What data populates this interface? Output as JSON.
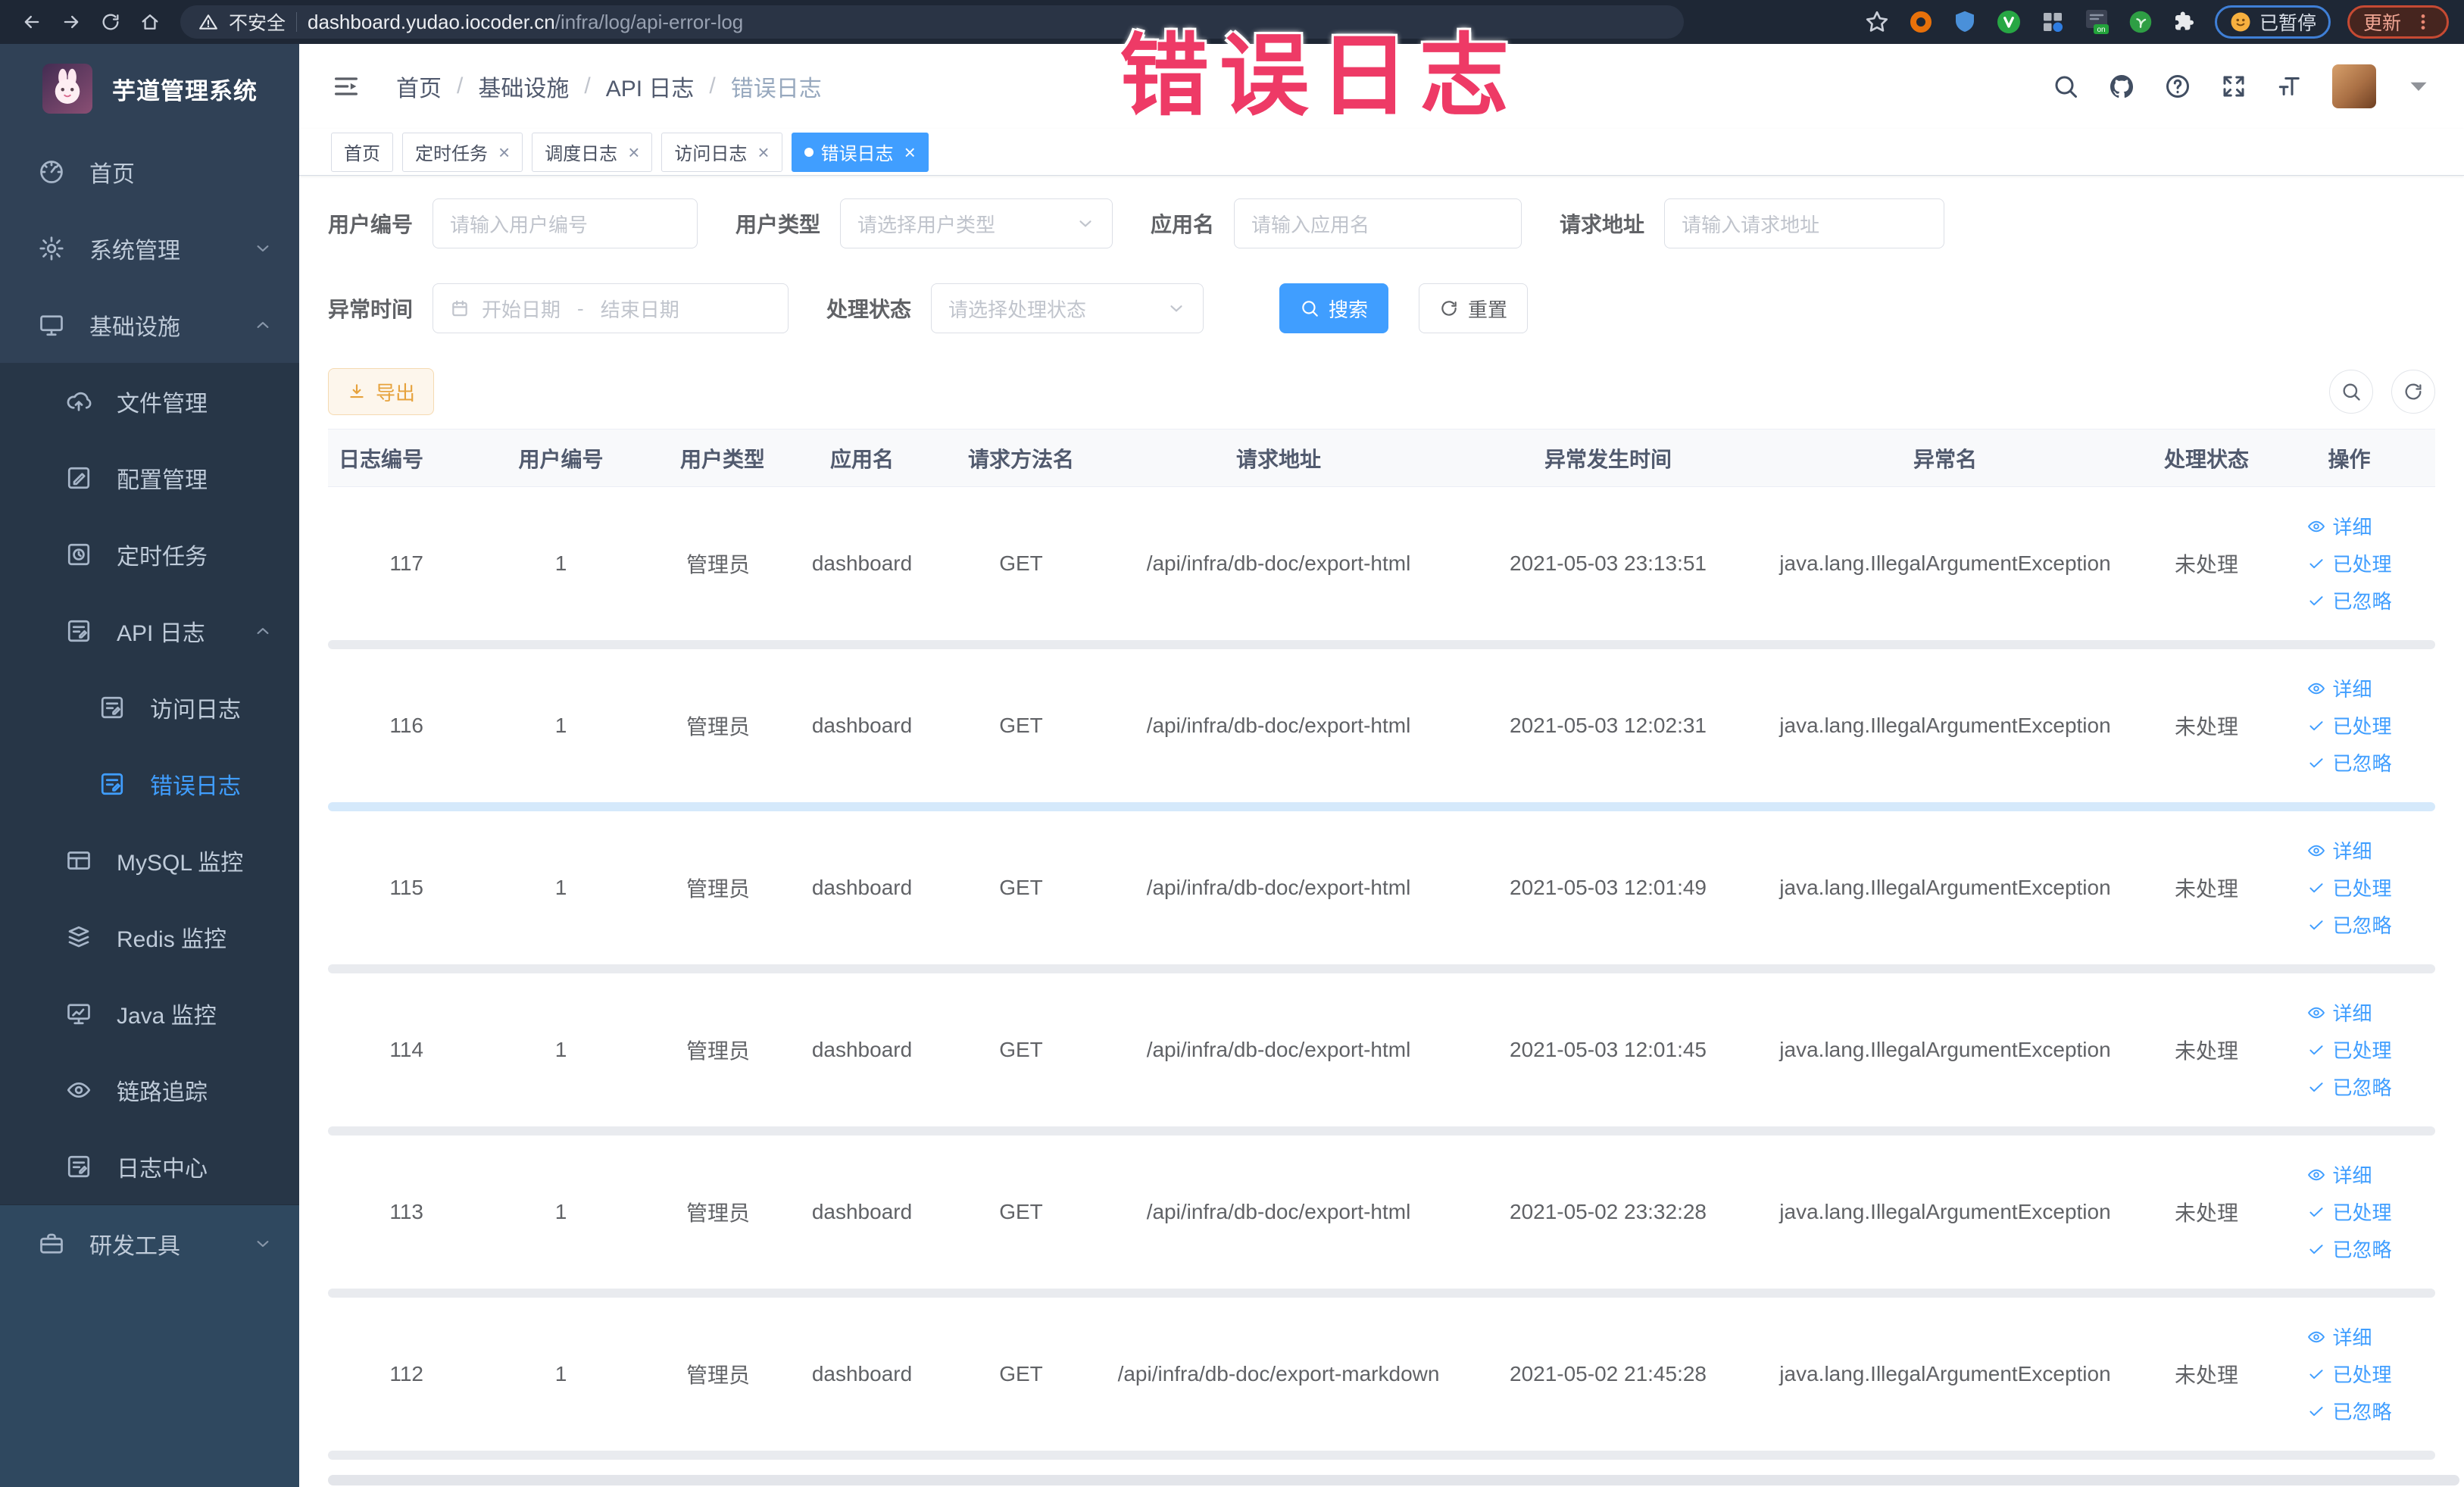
{
  "browser": {
    "security_label": "不安全",
    "url_host": "dashboard.yudao.iocoder.cn",
    "url_path": "/infra/log/api-error-log",
    "ext_on_badge": "on",
    "paused_badge": "已暂停",
    "update_label": "更新"
  },
  "watermark": "错误日志",
  "sidebar": {
    "title": "芋道管理系统",
    "items": [
      {
        "key": "home",
        "label": "首页",
        "icon": "dashboard-icon",
        "level": 1
      },
      {
        "key": "system",
        "label": "系统管理",
        "icon": "gear-icon",
        "level": 1,
        "chevron": "down"
      },
      {
        "key": "infra",
        "label": "基础设施",
        "icon": "monitor-icon",
        "level": 1,
        "chevron": "up"
      },
      {
        "key": "file",
        "label": "文件管理",
        "icon": "cloud-upload-icon",
        "level": 2,
        "dark": true
      },
      {
        "key": "config",
        "label": "配置管理",
        "icon": "edit-icon",
        "level": 2,
        "dark": true
      },
      {
        "key": "job",
        "label": "定时任务",
        "icon": "clock-icon",
        "level": 2,
        "dark": true
      },
      {
        "key": "api-log",
        "label": "API 日志",
        "icon": "log-icon",
        "level": 2,
        "chevron": "up",
        "dark": true
      },
      {
        "key": "access-log",
        "label": "访问日志",
        "icon": "log-icon",
        "level": 3,
        "dark": true
      },
      {
        "key": "error-log",
        "label": "错误日志",
        "icon": "log-icon",
        "level": 3,
        "dark": true,
        "active": true
      },
      {
        "key": "mysql",
        "label": "MySQL 监控",
        "icon": "database-icon",
        "level": 2,
        "dark": true
      },
      {
        "key": "redis",
        "label": "Redis 监控",
        "icon": "stack-icon",
        "level": 2,
        "dark": true
      },
      {
        "key": "java",
        "label": "Java 监控",
        "icon": "java-icon",
        "level": 2,
        "dark": true
      },
      {
        "key": "trace",
        "label": "链路追踪",
        "icon": "eye-icon",
        "level": 2,
        "dark": true
      },
      {
        "key": "log-center",
        "label": "日志中心",
        "icon": "log-icon",
        "level": 2,
        "dark": true
      },
      {
        "key": "dev-tools",
        "label": "研发工具",
        "icon": "briefcase-icon",
        "level": 1,
        "chevron": "down",
        "highlight": true
      }
    ]
  },
  "header": {
    "breadcrumb": [
      "首页",
      "基础设施",
      "API 日志",
      "错误日志"
    ]
  },
  "tabs": [
    {
      "key": "home",
      "label": "首页",
      "closable": false,
      "active": false
    },
    {
      "key": "job",
      "label": "定时任务",
      "closable": true,
      "active": false
    },
    {
      "key": "job-log",
      "label": "调度日志",
      "closable": true,
      "active": false
    },
    {
      "key": "access-log",
      "label": "访问日志",
      "closable": true,
      "active": false
    },
    {
      "key": "error-log",
      "label": "错误日志",
      "closable": true,
      "active": true
    }
  ],
  "filters": {
    "user_id": {
      "label": "用户编号",
      "placeholder": "请输入用户编号"
    },
    "user_type": {
      "label": "用户类型",
      "placeholder": "请选择用户类型"
    },
    "app_name": {
      "label": "应用名",
      "placeholder": "请输入应用名"
    },
    "request_url": {
      "label": "请求地址",
      "placeholder": "请输入请求地址"
    },
    "exception_time": {
      "label": "异常时间",
      "start_placeholder": "开始日期",
      "separator": "-",
      "end_placeholder": "结束日期"
    },
    "process_status": {
      "label": "处理状态",
      "placeholder": "请选择处理状态"
    },
    "search_label": "搜索",
    "reset_label": "重置"
  },
  "toolbar": {
    "export_label": "导出"
  },
  "table": {
    "columns": [
      "日志编号",
      "用户编号",
      "用户类型",
      "应用名",
      "请求方法名",
      "请求地址",
      "异常发生时间",
      "异常名",
      "处理状态",
      "操作"
    ],
    "action_labels": [
      "详细",
      "已处理",
      "已忽略"
    ],
    "rows": [
      {
        "id": "117",
        "user_id": "1",
        "user_type": "管理员",
        "app": "dashboard",
        "method": "GET",
        "url": "/api/infra/db-doc/export-html",
        "time": "2021-05-03 23:13:51",
        "exception": "java.lang.IllegalArgumentException",
        "status": "未处理",
        "divider": "gray"
      },
      {
        "id": "116",
        "user_id": "1",
        "user_type": "管理员",
        "app": "dashboard",
        "method": "GET",
        "url": "/api/infra/db-doc/export-html",
        "time": "2021-05-03 12:02:31",
        "exception": "java.lang.IllegalArgumentException",
        "status": "未处理",
        "divider": "blue"
      },
      {
        "id": "115",
        "user_id": "1",
        "user_type": "管理员",
        "app": "dashboard",
        "method": "GET",
        "url": "/api/infra/db-doc/export-html",
        "time": "2021-05-03 12:01:49",
        "exception": "java.lang.IllegalArgumentException",
        "status": "未处理",
        "divider": "gray"
      },
      {
        "id": "114",
        "user_id": "1",
        "user_type": "管理员",
        "app": "dashboard",
        "method": "GET",
        "url": "/api/infra/db-doc/export-html",
        "time": "2021-05-03 12:01:45",
        "exception": "java.lang.IllegalArgumentException",
        "status": "未处理",
        "divider": "gray"
      },
      {
        "id": "113",
        "user_id": "1",
        "user_type": "管理员",
        "app": "dashboard",
        "method": "GET",
        "url": "/api/infra/db-doc/export-html",
        "time": "2021-05-02 23:32:28",
        "exception": "java.lang.IllegalArgumentException",
        "status": "未处理",
        "divider": "gray"
      },
      {
        "id": "112",
        "user_id": "1",
        "user_type": "管理员",
        "app": "dashboard",
        "method": "GET",
        "url": "/api/infra/db-doc/export-markdown",
        "time": "2021-05-02 21:45:28",
        "exception": "java.lang.IllegalArgumentException",
        "status": "未处理",
        "divider": "gray"
      }
    ]
  }
}
